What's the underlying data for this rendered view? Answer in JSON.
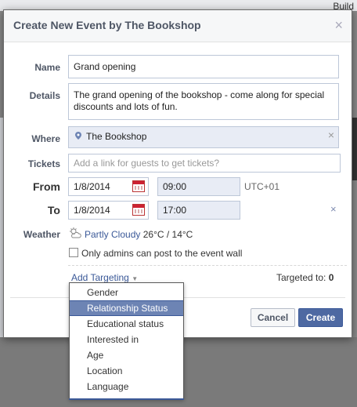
{
  "background": {
    "build_label": "Build"
  },
  "dialog": {
    "title": "Create New Event by The Bookshop",
    "close_icon": "close-icon"
  },
  "form": {
    "name": {
      "label": "Name",
      "value": "Grand opening"
    },
    "details": {
      "label": "Details",
      "value": "The grand opening of the bookshop - come along for special discounts and lots of fun."
    },
    "where": {
      "label": "Where",
      "value": "The Bookshop",
      "icon": "map-pin-icon"
    },
    "tickets": {
      "label": "Tickets",
      "placeholder": "Add a link for guests to get tickets?"
    },
    "from": {
      "label": "From",
      "date": "1/8/2014",
      "time": "09:00",
      "timezone": "UTC+01"
    },
    "to": {
      "label": "To",
      "date": "1/8/2014",
      "time": "17:00"
    },
    "weather": {
      "label": "Weather",
      "condition": "Partly Cloudy",
      "temps": "26°C / 14°C",
      "icon": "partly-cloudy-icon"
    },
    "admins_only": {
      "label": "Only admins can post to the event wall",
      "checked": false
    },
    "targeting": {
      "link": "Add Targeting",
      "targeted_label": "Targeted to:",
      "targeted_count": "0"
    }
  },
  "buttons": {
    "cancel": "Cancel",
    "create": "Create"
  },
  "dropdown": {
    "selected": "Relationship Status",
    "items": [
      {
        "label": "Gender"
      },
      {
        "label": "Relationship Status"
      },
      {
        "label": "Educational status"
      },
      {
        "label": "Interested in"
      },
      {
        "label": "Age"
      },
      {
        "label": "Location"
      },
      {
        "label": "Language"
      }
    ]
  },
  "colors": {
    "accent": "#3b5998",
    "selected_item": "#6d84b4",
    "filled_field": "#e8ecf5"
  }
}
